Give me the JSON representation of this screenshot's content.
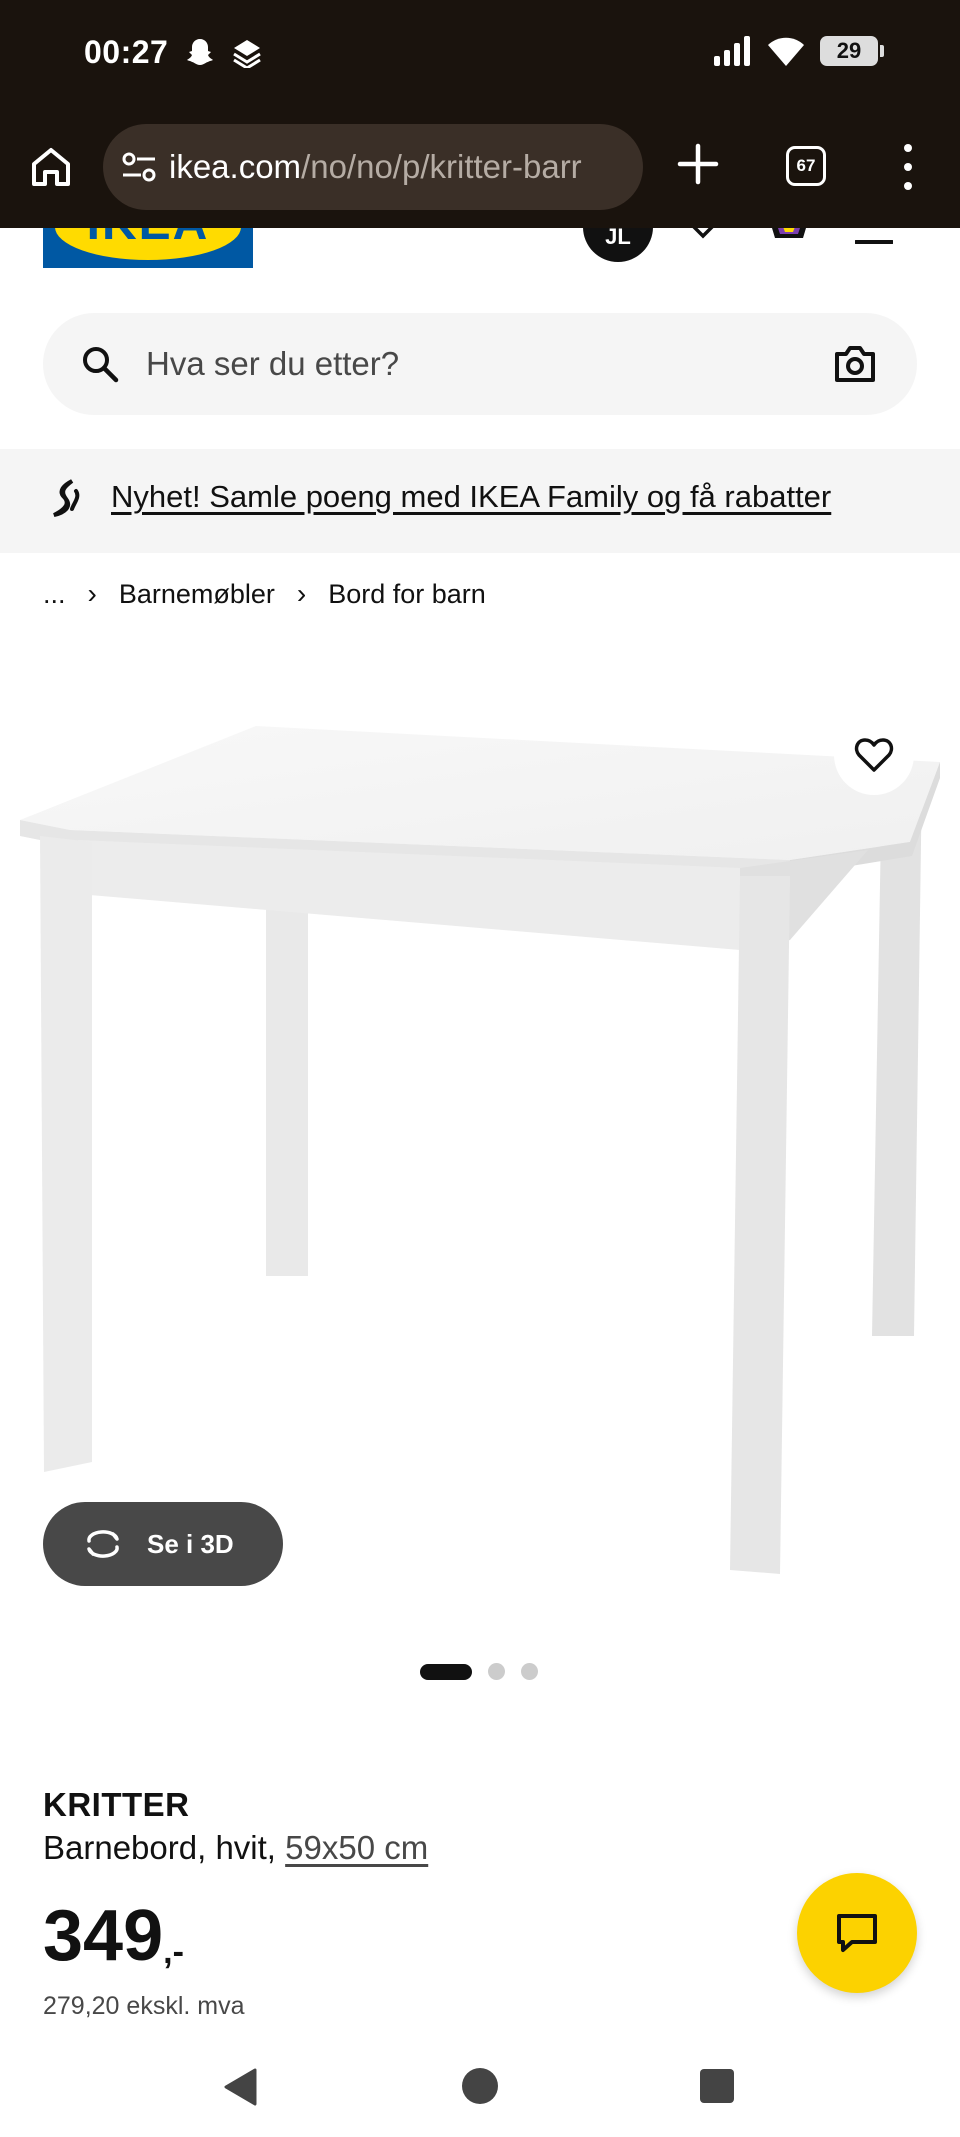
{
  "status_bar": {
    "time": "00:27",
    "battery": "29",
    "left_icons": [
      "snapchat-icon",
      "notification-stack-icon"
    ],
    "right_icons": [
      "signal-icon",
      "wifi-icon",
      "battery-icon"
    ]
  },
  "browser": {
    "url_host": "ikea.com",
    "url_path": "/no/no/p/kritter-barr",
    "tab_count": "67"
  },
  "header": {
    "logo_text": "IKEA",
    "avatar_initials": "JL"
  },
  "search": {
    "placeholder": "Hva ser du etter?"
  },
  "banner": {
    "text": "Nyhet! Samle poeng med IKEA Family og få rabatter"
  },
  "breadcrumb": {
    "items": [
      "...",
      "Barnemøbler",
      "Bord for barn"
    ]
  },
  "gallery": {
    "view_3d_label": "Se i 3D",
    "image_count": 3,
    "active_index": 0
  },
  "product": {
    "name": "KRITTER",
    "description": "Barnebord, hvit, ",
    "size": "59x50 cm",
    "price_integer": "349",
    "price_suffix": ",-",
    "price_excl_vat": "279,20 ekskl. mva"
  },
  "colors": {
    "browser_chrome": "#1a130d",
    "ikea_blue": "#0058a3",
    "ikea_yellow": "#ffdb00",
    "chat_button": "#fcd200"
  }
}
